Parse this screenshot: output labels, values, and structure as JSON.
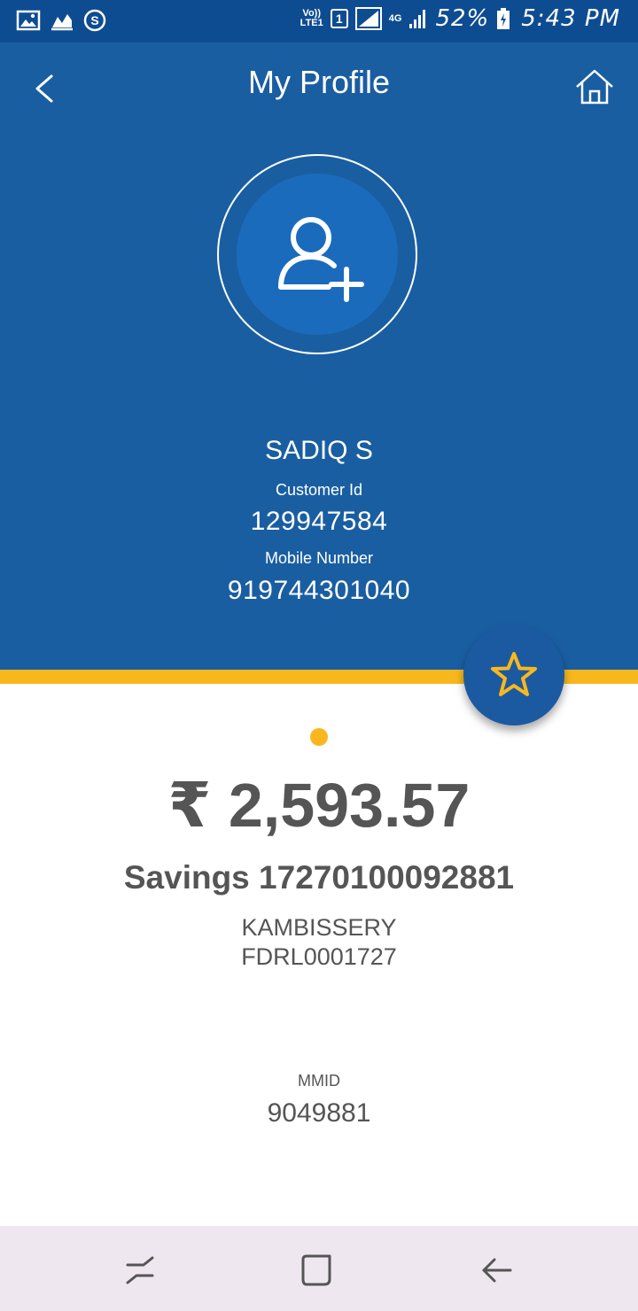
{
  "status_bar": {
    "volte_top": "Vo))",
    "volte_bottom": "LTE1",
    "sim": "1",
    "network": "4G",
    "battery": "52%",
    "time": "5:43 PM"
  },
  "header": {
    "title": "My Profile"
  },
  "profile": {
    "name": "SADIQ S",
    "customer_id_label": "Customer Id",
    "customer_id": "129947584",
    "mobile_label": "Mobile Number",
    "mobile": "919744301040"
  },
  "account": {
    "balance": "₹ 2,593.57",
    "type_number": "Savings 17270100092881",
    "branch": "KAMBISSERY",
    "ifsc": "FDRL0001727",
    "mmid_label": "MMID",
    "mmid": "9049881"
  },
  "colors": {
    "header_bg": "#1a5ea2",
    "accent": "#f8b81d",
    "text_gray": "#555555",
    "nav_bg": "#efe7ef"
  },
  "icons": [
    "gallery-icon",
    "chart-icon",
    "s-icon",
    "back-icon",
    "home-icon",
    "add-user-icon",
    "star-icon",
    "recent-apps-icon",
    "home-nav-icon",
    "back-nav-icon"
  ]
}
